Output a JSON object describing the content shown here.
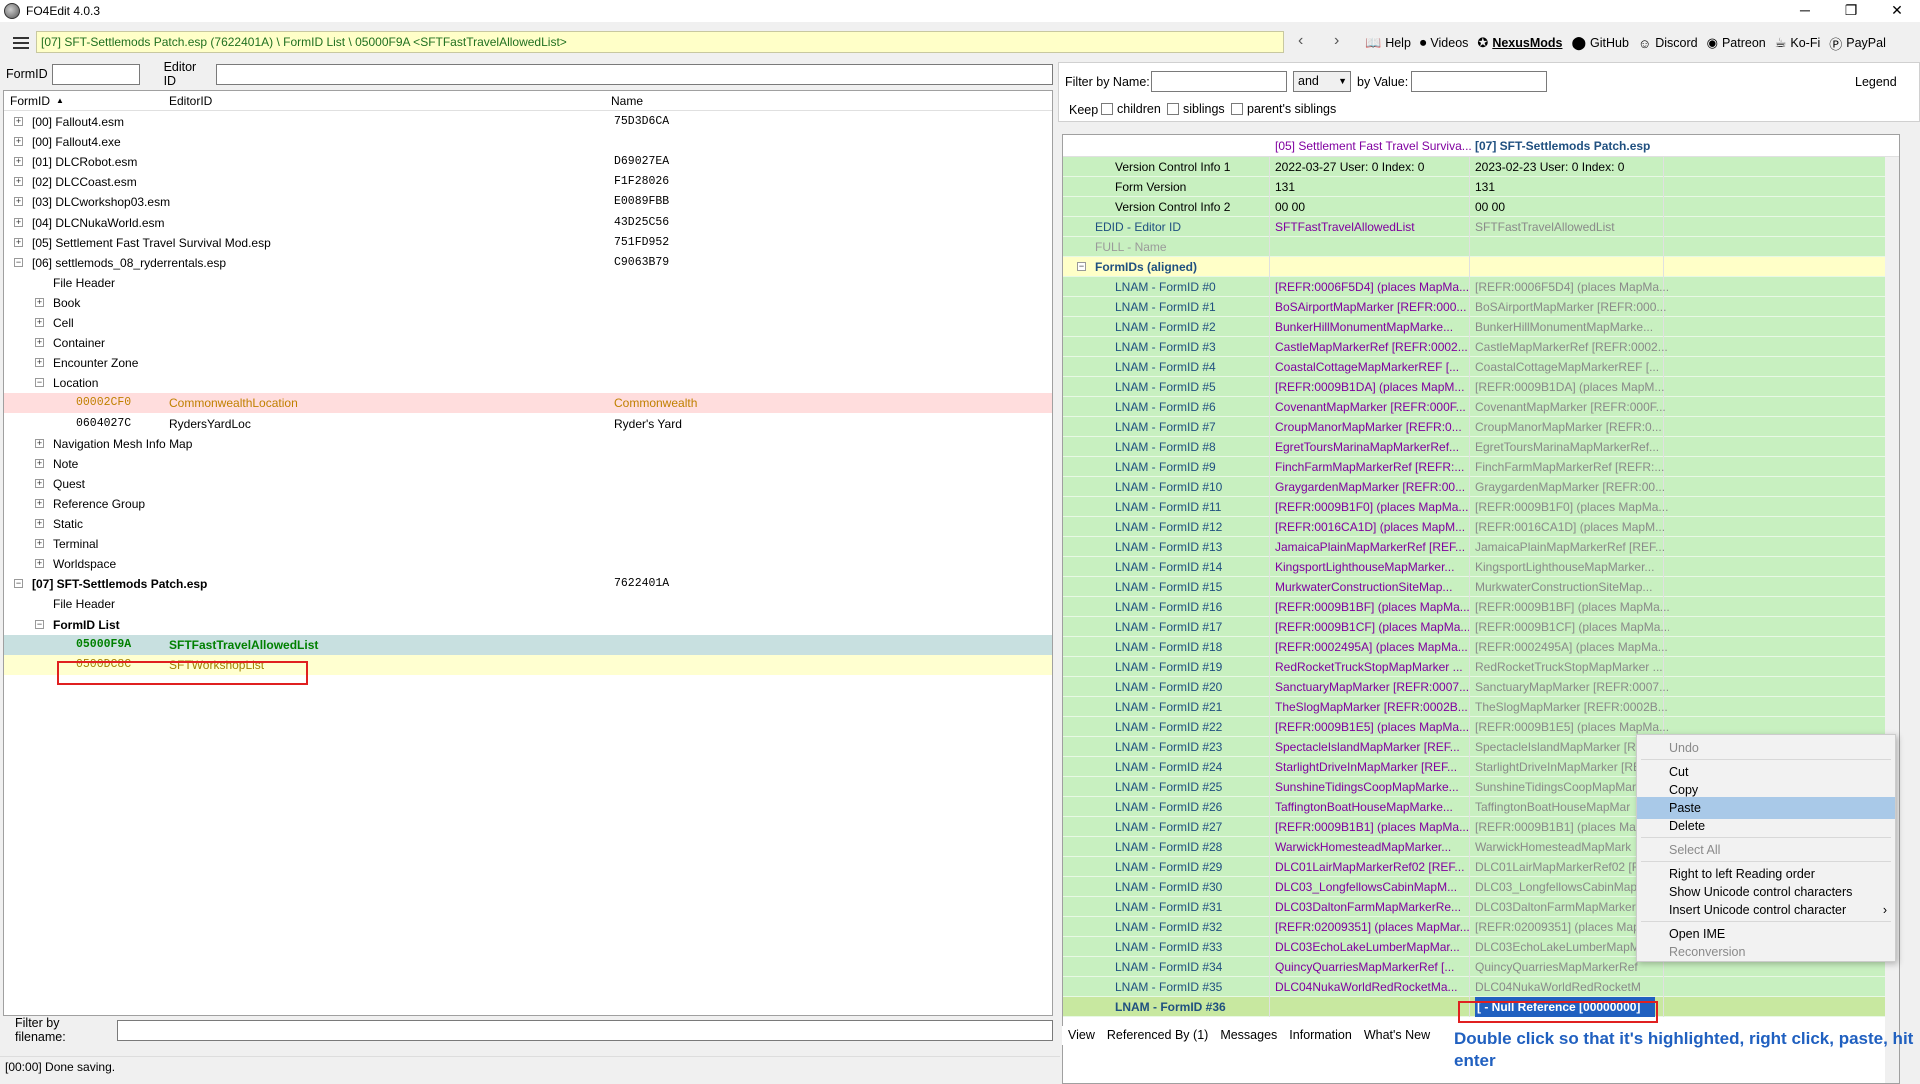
{
  "window": {
    "title": "FO4Edit 4.0.3",
    "minimize": "─",
    "maximize": "❐",
    "close": "✕"
  },
  "toolbar": {
    "path": "[07] SFT-Settlemods Patch.esp (7622401A) \\ FormID List \\ 05000F9A <SFTFastTravelAllowedList>",
    "links": [
      {
        "label": "Help",
        "icon": "help-book-icon"
      },
      {
        "label": "Videos",
        "icon": "videos-icon"
      },
      {
        "label": "NexusMods",
        "icon": "nexusmods-icon"
      },
      {
        "label": "GitHub",
        "icon": "github-icon"
      },
      {
        "label": "Discord",
        "icon": "discord-icon"
      },
      {
        "label": "Patreon",
        "icon": "patreon-icon"
      },
      {
        "label": "Ko-Fi",
        "icon": "kofi-icon"
      },
      {
        "label": "PayPal",
        "icon": "paypal-icon"
      }
    ]
  },
  "left": {
    "formid_label": "FormID",
    "editorid_label": "Editor ID",
    "columns": [
      "FormID",
      "EditorID",
      "Name"
    ],
    "tree": [
      {
        "indent": 0,
        "exp": "+",
        "id": "[00] Fallout4.esm",
        "editor": "",
        "name": "75D3D6CA",
        "style": "normal"
      },
      {
        "indent": 0,
        "exp": "+",
        "id": "[00] Fallout4.exe",
        "editor": "",
        "name": "",
        "style": "normal"
      },
      {
        "indent": 0,
        "exp": "+",
        "id": "[01] DLCRobot.esm",
        "editor": "",
        "name": "D69027EA",
        "style": "normal"
      },
      {
        "indent": 0,
        "exp": "+",
        "id": "[02] DLCCoast.esm",
        "editor": "",
        "name": "F1F28026",
        "style": "normal"
      },
      {
        "indent": 0,
        "exp": "+",
        "id": "[03] DLCworkshop03.esm",
        "editor": "",
        "name": "E0089FBB",
        "style": "normal"
      },
      {
        "indent": 0,
        "exp": "+",
        "id": "[04] DLCNukaWorld.esm",
        "editor": "",
        "name": "43D25C56",
        "style": "normal"
      },
      {
        "indent": 0,
        "exp": "+",
        "id": "[05] Settlement Fast Travel Survival Mod.esp",
        "editor": "",
        "name": "751FD952",
        "style": "normal"
      },
      {
        "indent": 0,
        "exp": "-",
        "id": "[06] settlemods_08_ryderrentals.esp",
        "editor": "",
        "name": "C9063B79",
        "style": "normal"
      },
      {
        "indent": 1,
        "exp": "",
        "id": "File Header",
        "editor": "",
        "name": "",
        "style": "normal"
      },
      {
        "indent": 1,
        "exp": "+",
        "id": "Book",
        "editor": "",
        "name": "",
        "style": "normal"
      },
      {
        "indent": 1,
        "exp": "+",
        "id": "Cell",
        "editor": "",
        "name": "",
        "style": "normal"
      },
      {
        "indent": 1,
        "exp": "+",
        "id": "Container",
        "editor": "",
        "name": "",
        "style": "normal"
      },
      {
        "indent": 1,
        "exp": "+",
        "id": "Encounter Zone",
        "editor": "",
        "name": "",
        "style": "normal"
      },
      {
        "indent": 1,
        "exp": "-",
        "id": "Location",
        "editor": "",
        "name": "",
        "style": "normal"
      },
      {
        "indent": 2,
        "exp": "",
        "id": "00002CF0",
        "editor": "CommonwealthLocation",
        "name": "Commonwealth",
        "style": "red"
      },
      {
        "indent": 2,
        "exp": "",
        "id": "0604027C",
        "editor": "RydersYardLoc",
        "name": "Ryder's Yard",
        "style": "normal"
      },
      {
        "indent": 1,
        "exp": "+",
        "id": "Navigation Mesh Info Map",
        "editor": "",
        "name": "",
        "style": "normal"
      },
      {
        "indent": 1,
        "exp": "+",
        "id": "Note",
        "editor": "",
        "name": "",
        "style": "normal"
      },
      {
        "indent": 1,
        "exp": "+",
        "id": "Quest",
        "editor": "",
        "name": "",
        "style": "normal"
      },
      {
        "indent": 1,
        "exp": "+",
        "id": "Reference Group",
        "editor": "",
        "name": "",
        "style": "normal"
      },
      {
        "indent": 1,
        "exp": "+",
        "id": "Static",
        "editor": "",
        "name": "",
        "style": "normal"
      },
      {
        "indent": 1,
        "exp": "+",
        "id": "Terminal",
        "editor": "",
        "name": "",
        "style": "normal"
      },
      {
        "indent": 1,
        "exp": "+",
        "id": "Worldspace",
        "editor": "",
        "name": "",
        "style": "normal"
      },
      {
        "indent": 0,
        "exp": "-",
        "id": "[07] SFT-Settlemods Patch.esp",
        "editor": "",
        "name": "7622401A",
        "style": "bold"
      },
      {
        "indent": 1,
        "exp": "",
        "id": "File Header",
        "editor": "",
        "name": "",
        "style": "normal"
      },
      {
        "indent": 1,
        "exp": "-",
        "id": "FormID List",
        "editor": "",
        "name": "",
        "style": "bold"
      },
      {
        "indent": 2,
        "exp": "",
        "id": "05000F9A",
        "editor": "SFTFastTravelAllowedList",
        "name": "",
        "style": "selected"
      },
      {
        "indent": 2,
        "exp": "",
        "id": "0500DC8C",
        "editor": "SFTWorkshopList",
        "name": "",
        "style": "yellow"
      }
    ],
    "filter_filename_label": "Filter by filename:"
  },
  "status": "[00:00] Done saving.",
  "right": {
    "filter_name_label": "Filter by Name:",
    "and_value": "and",
    "by_value_label": "by Value:",
    "legend": "Legend",
    "keep_label": "Keep",
    "children": "children",
    "siblings": "siblings",
    "parents_siblings": "parent's siblings",
    "col1": "[05] Settlement Fast Travel Surviva...",
    "col2": "[07] SFT-Settlemods Patch.esp",
    "top_rows": [
      {
        "label": "Version Control Info 1",
        "v1": "2022-03-27 User: 0 Index: 0",
        "v2": "2023-02-23 User: 0 Index: 0"
      },
      {
        "label": "Form Version",
        "v1": "131",
        "v2": "131"
      },
      {
        "label": "Version Control Info 2",
        "v1": "00 00",
        "v2": "00 00"
      }
    ],
    "edid_label": "EDID - Editor ID",
    "edid_v1": "SFTFastTravelAllowedList",
    "edid_v2": "SFTFastTravelAllowedList",
    "full_label": "FULL - Name",
    "formids_label": "FormIDs (aligned)",
    "lnam_rows": [
      {
        "label": "LNAM - FormID #0",
        "v1": "[REFR:0006F5D4] (places MapMa...",
        "v2": "[REFR:0006F5D4] (places MapMa..."
      },
      {
        "label": "LNAM - FormID #1",
        "v1": "BoSAirportMapMarker [REFR:000...",
        "v2": "BoSAirportMapMarker [REFR:000..."
      },
      {
        "label": "LNAM - FormID #2",
        "v1": "BunkerHillMonumentMapMarke...",
        "v2": "BunkerHillMonumentMapMarke..."
      },
      {
        "label": "LNAM - FormID #3",
        "v1": "CastleMapMarkerRef [REFR:0002...",
        "v2": "CastleMapMarkerRef [REFR:0002..."
      },
      {
        "label": "LNAM - FormID #4",
        "v1": "CoastalCottageMapMarkerREF [...",
        "v2": "CoastalCottageMapMarkerREF [..."
      },
      {
        "label": "LNAM - FormID #5",
        "v1": "[REFR:0009B1DA] (places MapM...",
        "v2": "[REFR:0009B1DA] (places MapM..."
      },
      {
        "label": "LNAM - FormID #6",
        "v1": "CovenantMapMarker [REFR:000F...",
        "v2": "CovenantMapMarker [REFR:000F..."
      },
      {
        "label": "LNAM - FormID #7",
        "v1": "CroupManorMapMarker [REFR:0...",
        "v2": "CroupManorMapMarker [REFR:0..."
      },
      {
        "label": "LNAM - FormID #8",
        "v1": "EgretToursMarinaMapMarkerRef...",
        "v2": "EgretToursMarinaMapMarkerRef..."
      },
      {
        "label": "LNAM - FormID #9",
        "v1": "FinchFarmMapMarkerRef [REFR:...",
        "v2": "FinchFarmMapMarkerRef [REFR:..."
      },
      {
        "label": "LNAM - FormID #10",
        "v1": "GraygardenMapMarker [REFR:00...",
        "v2": "GraygardenMapMarker [REFR:00..."
      },
      {
        "label": "LNAM - FormID #11",
        "v1": "[REFR:0009B1F0] (places MapMa...",
        "v2": "[REFR:0009B1F0] (places MapMa..."
      },
      {
        "label": "LNAM - FormID #12",
        "v1": "[REFR:0016CA1D] (places MapM...",
        "v2": "[REFR:0016CA1D] (places MapM..."
      },
      {
        "label": "LNAM - FormID #13",
        "v1": "JamaicaPlainMapMarkerRef [REF...",
        "v2": "JamaicaPlainMapMarkerRef [REF..."
      },
      {
        "label": "LNAM - FormID #14",
        "v1": "KingsportLighthouseMapMarker...",
        "v2": "KingsportLighthouseMapMarker..."
      },
      {
        "label": "LNAM - FormID #15",
        "v1": "MurkwaterConstructionSiteMap...",
        "v2": "MurkwaterConstructionSiteMap..."
      },
      {
        "label": "LNAM - FormID #16",
        "v1": "[REFR:0009B1BF] (places MapMa...",
        "v2": "[REFR:0009B1BF] (places MapMa..."
      },
      {
        "label": "LNAM - FormID #17",
        "v1": "[REFR:0009B1CF] (places MapMa...",
        "v2": "[REFR:0009B1CF] (places MapMa..."
      },
      {
        "label": "LNAM - FormID #18",
        "v1": "[REFR:0002495A] (places MapMa...",
        "v2": "[REFR:0002495A] (places MapMa..."
      },
      {
        "label": "LNAM - FormID #19",
        "v1": "RedRocketTruckStopMapMarker ...",
        "v2": "RedRocketTruckStopMapMarker ..."
      },
      {
        "label": "LNAM - FormID #20",
        "v1": "SanctuaryMapMarker [REFR:0007...",
        "v2": "SanctuaryMapMarker [REFR:0007..."
      },
      {
        "label": "LNAM - FormID #21",
        "v1": "TheSlogMapMarker [REFR:0002B...",
        "v2": "TheSlogMapMarker [REFR:0002B..."
      },
      {
        "label": "LNAM - FormID #22",
        "v1": "[REFR:0009B1E5] (places MapMa...",
        "v2": "[REFR:0009B1E5] (places MapMa..."
      },
      {
        "label": "LNAM - FormID #23",
        "v1": "SpectacleIslandMapMarker [REF...",
        "v2": "SpectacleIslandMapMarker [RE"
      },
      {
        "label": "LNAM - FormID #24",
        "v1": "StarlightDriveInMapMarker [REF...",
        "v2": "StarlightDriveInMapMarker [RE"
      },
      {
        "label": "LNAM - FormID #25",
        "v1": "SunshineTidingsCoopMapMarke...",
        "v2": "SunshineTidingsCoopMapMar"
      },
      {
        "label": "LNAM - FormID #26",
        "v1": "TaffingtonBoatHouseMapMarke...",
        "v2": "TaffingtonBoatHouseMapMar"
      },
      {
        "label": "LNAM - FormID #27",
        "v1": "[REFR:0009B1B1] (places MapMa...",
        "v2": "[REFR:0009B1B1] (places MapM"
      },
      {
        "label": "LNAM - FormID #28",
        "v1": "WarwickHomesteadMapMarker...",
        "v2": "WarwickHomesteadMapMark"
      },
      {
        "label": "LNAM - FormID #29",
        "v1": "DLC01LairMapMarkerRef02 [REF...",
        "v2": "DLC01LairMapMarkerRef02 [R"
      },
      {
        "label": "LNAM - FormID #30",
        "v1": "DLC03_LongfellowsCabinMapM...",
        "v2": "DLC03_LongfellowsCabinMap"
      },
      {
        "label": "LNAM - FormID #31",
        "v1": "DLC03DaltonFarmMapMarkerRe...",
        "v2": "DLC03DaltonFarmMapMarker"
      },
      {
        "label": "LNAM - FormID #32",
        "v1": "[REFR:02009351] (places MapMar...",
        "v2": "[REFR:02009351] (places Map"
      },
      {
        "label": "LNAM - FormID #33",
        "v1": "DLC03EchoLakeLumberMapMar...",
        "v2": "DLC03EchoLakeLumberMapM"
      },
      {
        "label": "LNAM - FormID #34",
        "v1": "QuincyQuarriesMapMarkerRef [...",
        "v2": "QuincyQuarriesMapMarkerRef"
      },
      {
        "label": "LNAM - FormID #35",
        "v1": "DLC04NukaWorldRedRocketMa...",
        "v2": "DLC04NukaWorldRedRocketM"
      }
    ],
    "last_label": "LNAM - FormID #36",
    "last_v2": "[ - Null Reference [00000000]",
    "tabs": [
      "View",
      "Referenced By (1)",
      "Messages",
      "Information",
      "What's New"
    ]
  },
  "context_menu": {
    "items": [
      {
        "label": "Undo",
        "disabled": true
      },
      {
        "label": "Cut",
        "disabled": false
      },
      {
        "label": "Copy",
        "disabled": false
      },
      {
        "label": "Paste",
        "disabled": false,
        "highlight": true
      },
      {
        "label": "Delete",
        "disabled": false
      },
      {
        "label": "Select All",
        "disabled": true
      },
      {
        "label": "Right to left Reading order",
        "disabled": false
      },
      {
        "label": "Show Unicode control characters",
        "disabled": false
      },
      {
        "label": "Insert Unicode control character",
        "disabled": false,
        "submenu": true
      },
      {
        "label": "Open IME",
        "disabled": false
      },
      {
        "label": "Reconversion",
        "disabled": true
      }
    ]
  },
  "annotation": "Double click so that it's highlighted, right click, paste, hit enter",
  "colors": {
    "accent_green": "#c8f0c0",
    "selection": "#a9c9e8",
    "red_box": "#e02020",
    "annotation": "#2060c0"
  }
}
